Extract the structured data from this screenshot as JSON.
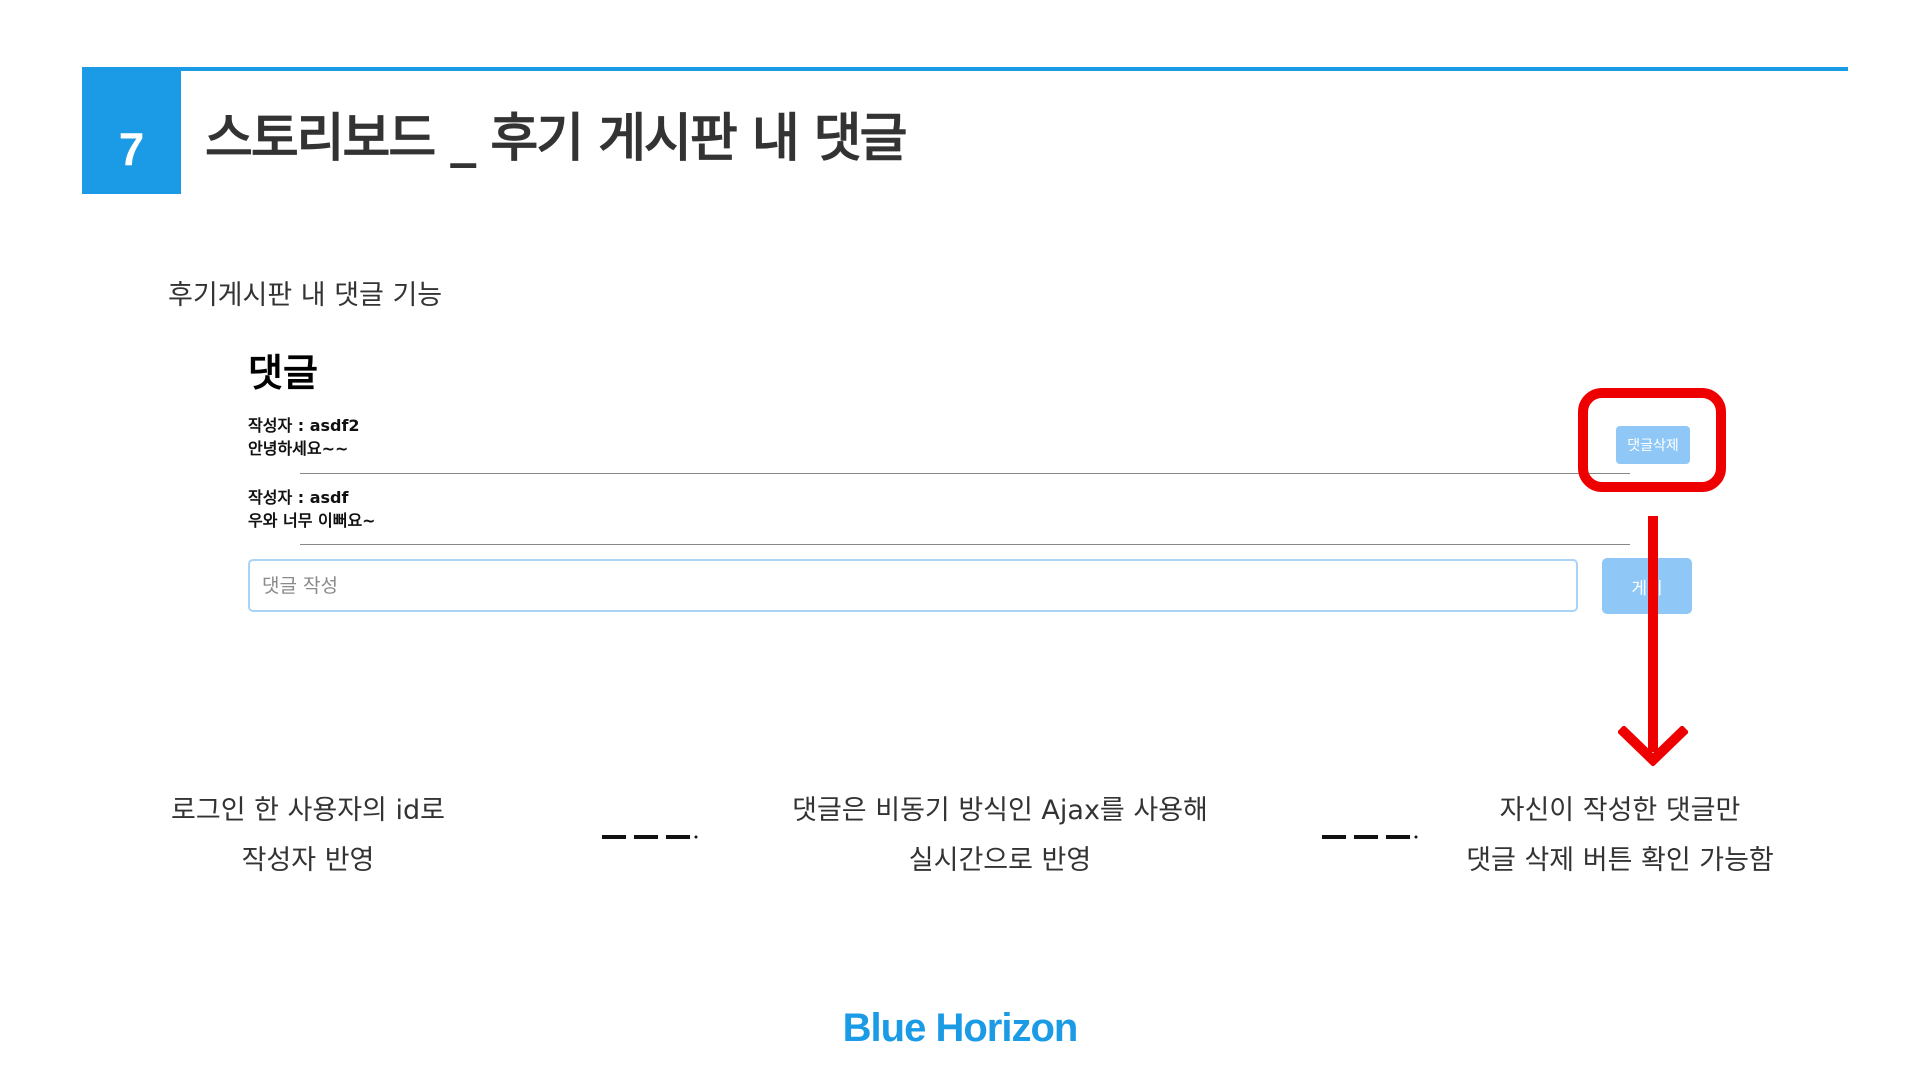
{
  "header": {
    "section_number": "7",
    "title": "스토리보드 _  후기 게시판 내 댓글"
  },
  "subtitle": "후기게시판 내 댓글 기능",
  "comment_panel": {
    "heading": "댓글",
    "comments": [
      {
        "author": "작성자 : asdf2",
        "content": "안녕하세요~~"
      },
      {
        "author": "작성자 : asdf",
        "content": "우와 너무 이뻐요~"
      }
    ],
    "delete_label": "댓글삭제",
    "input_placeholder": "댓글 작성",
    "post_label": "게시"
  },
  "captions": {
    "left": [
      "로그인 한 사용자의 id로",
      "작성자 반영"
    ],
    "middle": [
      "댓글은 비동기 방식인 Ajax를 사용해",
      "실시간으로 반영"
    ],
    "right": [
      "자신이 작성한 댓글만",
      "댓글 삭제 버튼 확인 가능함"
    ]
  },
  "footer": {
    "brand": "Blue Horizon"
  },
  "colors": {
    "brand": "#1b9be6",
    "highlight": "#ee0000",
    "button": "#8fc8f7"
  }
}
